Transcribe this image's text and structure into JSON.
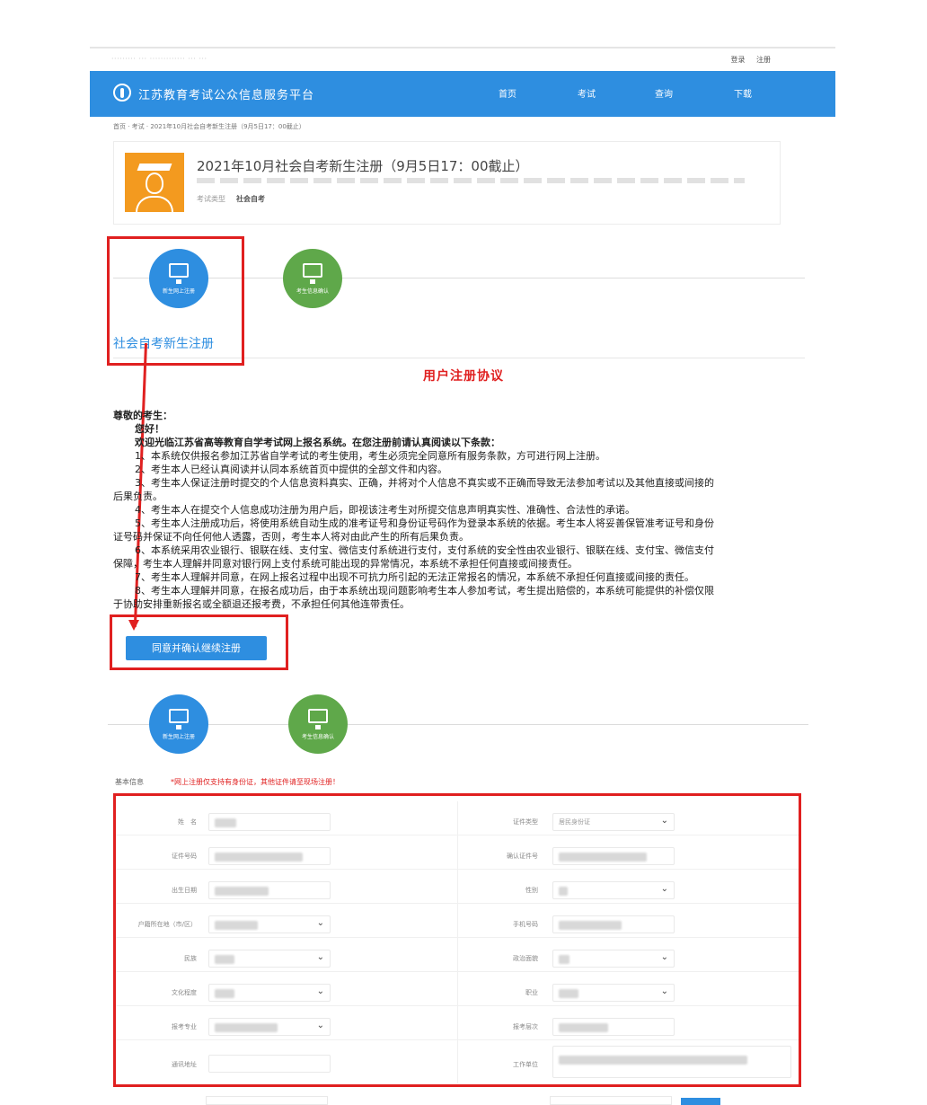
{
  "topbar": {
    "notice": "········· ··· ············· ··· ···",
    "links": [
      "登录",
      "注册"
    ]
  },
  "header": {
    "site_title": "江苏教育考试公众信息服务平台",
    "nav": [
      "首页",
      "考试",
      "查询",
      "下载"
    ]
  },
  "breadcrumb": "首页 · 考试 · 2021年10月社会自考新生注册（9月5日17：00截止）",
  "exam": {
    "title": "2021年10月社会自考新生注册（9月5日17：00截止）",
    "meta_label": "考试类型",
    "meta_value": "社会自考"
  },
  "steps": {
    "step1_name": "新生网上注册",
    "step2_name": "考生信息确认",
    "step1_label": "社会自考新生注册"
  },
  "agreement": {
    "title": "用户注册协议",
    "greeting": "尊敬的考生：",
    "hello": "您好！",
    "intro": "欢迎光临江苏省高等教育自学考试网上报名系统。在您注册前请认真阅读以下条款：",
    "items": [
      "1、本系统仅供报名参加江苏省自学考试的考生使用，考生必须完全同意所有服务条款，方可进行网上注册。",
      "2、考生本人已经认真阅读并认同本系统首页中提供的全部文件和内容。",
      "3、考生本人保证注册时提交的个人信息资料真实、正确，并将对个人信息不真实或不正确而导致无法参加考试以及其他直接或间接的",
      "后果负责。",
      "4、考生本人在提交个人信息成功注册为用户后，即视该注考生对所提交信息声明真实性、准确性、合法性的承诺。",
      "5、考生本人注册成功后，将使用系统自动生成的准考证号和身份证号码作为登录本系统的依据。考生本人将妥善保管准考证号和身份",
      "证号码并保证不向任何他人透露，否则，考生本人将对由此产生的所有后果负责。",
      "6、本系统采用农业银行、银联在线、支付宝、微信支付系统进行支付，支付系统的安全性由农业银行、银联在线、支付宝、微信支付",
      "保障，考生本人理解并同意对银行网上支付系统可能出现的异常情况，本系统不承担任何直接或间接责任。",
      "7、考生本人理解并同意，在网上报名过程中出现不可抗力所引起的无法正常报名的情况，本系统不承担任何直接或间接的责任。",
      "8、考生本人理解并同意，在报名成功后，由于本系统出现问题影响考生本人参加考试，考生提出赔偿的，本系统可能提供的补偿仅限",
      "于协助安排重新报名或全额退还报考费，不承担任何其他连带责任。"
    ],
    "agree_button": "同意并确认继续注册"
  },
  "form": {
    "section_label": "基本信息",
    "section_note": "*网上注册仅支持有身份证，其他证件请至现场注册！",
    "rows": [
      {
        "left_label": "姓　名",
        "right_label": "证件类型"
      },
      {
        "left_label": "证件号码",
        "right_label": "确认证件号"
      },
      {
        "left_label": "出生日期",
        "right_label": "性别"
      },
      {
        "left_label": "户籍所在地（市/区）",
        "right_label": "手机号码"
      },
      {
        "left_label": "民族",
        "right_label": "政治面貌"
      },
      {
        "left_label": "文化程度",
        "right_label": "职业"
      },
      {
        "left_label": "报考专业",
        "right_label": "报考层次"
      },
      {
        "left_label": "通讯地址",
        "right_label": "工作单位"
      }
    ],
    "id_type_value": "居民身份证"
  },
  "colors": {
    "brand_blue": "#2e8ee0",
    "accent_red": "#e02020",
    "avatar_orange": "#f39a1f",
    "step_green": "#5fa84a"
  }
}
